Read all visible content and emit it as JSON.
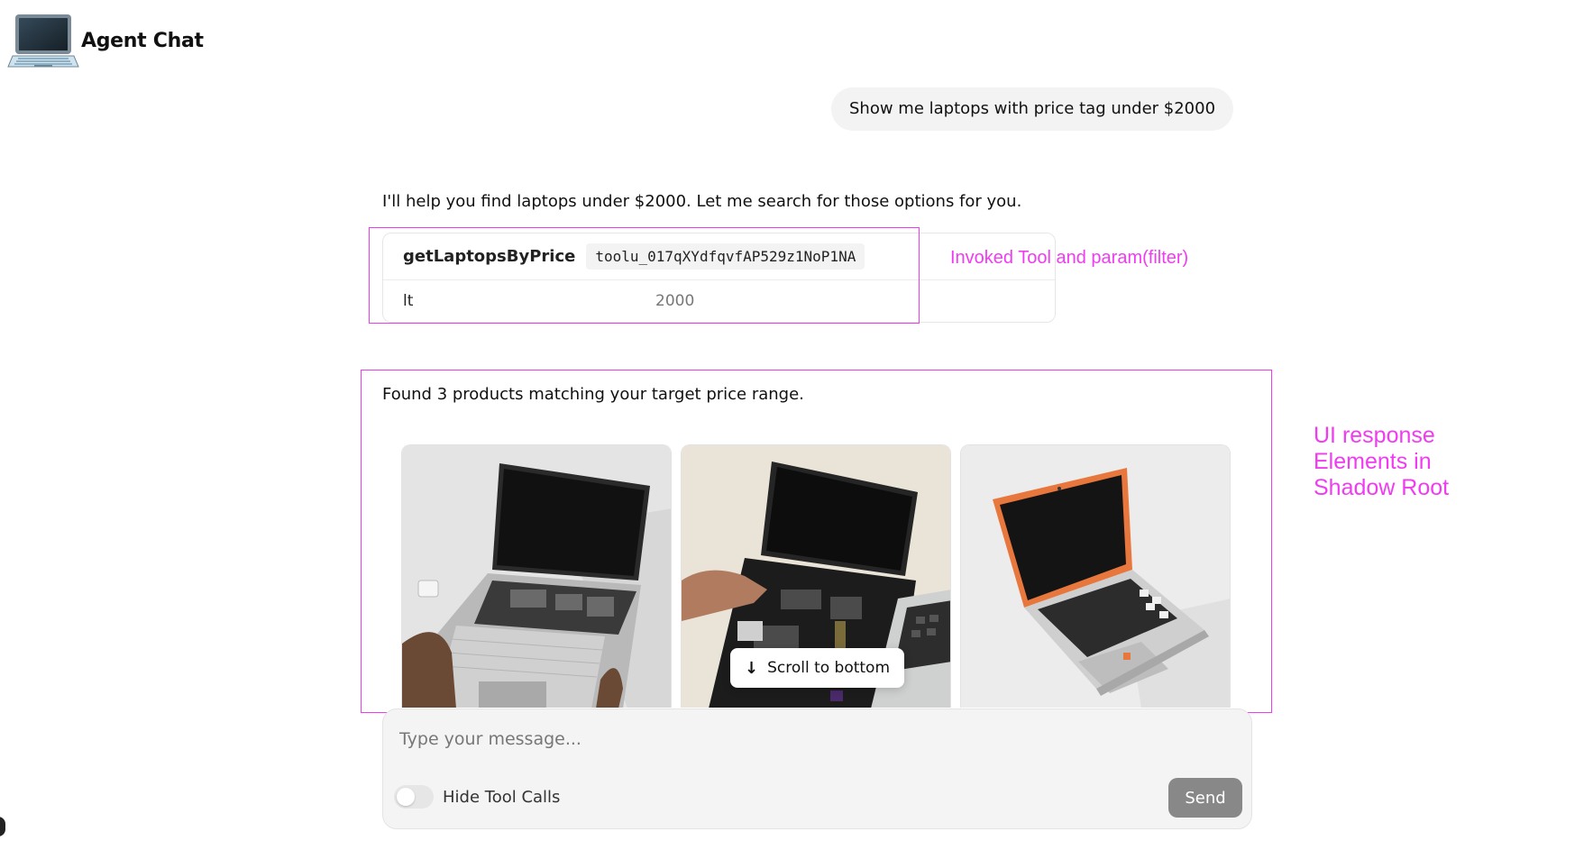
{
  "header": {
    "title": "Agent Chat",
    "logo_icon": "laptop-icon"
  },
  "conversation": {
    "user_message": "Show me laptops with price tag under $2000",
    "assistant_message": "I'll help you find laptops under $2000. Let me search for those options for you.",
    "tool_call": {
      "name": "getLaptopsByPrice",
      "id": "toolu_017qXYdfqvfAP529z1NoP1NA",
      "params": [
        {
          "key": "lt",
          "value": "2000"
        }
      ]
    },
    "ui_response": {
      "text": "Found 3 products matching your target price range.",
      "products": [
        {
          "image": "laptop-open-modular-silver"
        },
        {
          "image": "laptop-being-assembled-black"
        },
        {
          "image": "laptop-orange-bezel"
        }
      ]
    }
  },
  "annotations": {
    "tool_note": "Invoked Tool and param(filter)",
    "ui_note_lines": [
      "UI response",
      "Elements in",
      "Shadow Root"
    ],
    "color": "#f03cf0"
  },
  "scroll_button": {
    "label": "Scroll to bottom",
    "icon": "arrow-down-icon"
  },
  "composer": {
    "placeholder": "Type your message...",
    "toggle_label": "Hide Tool Calls",
    "toggle_on": false,
    "send_label": "Send"
  }
}
